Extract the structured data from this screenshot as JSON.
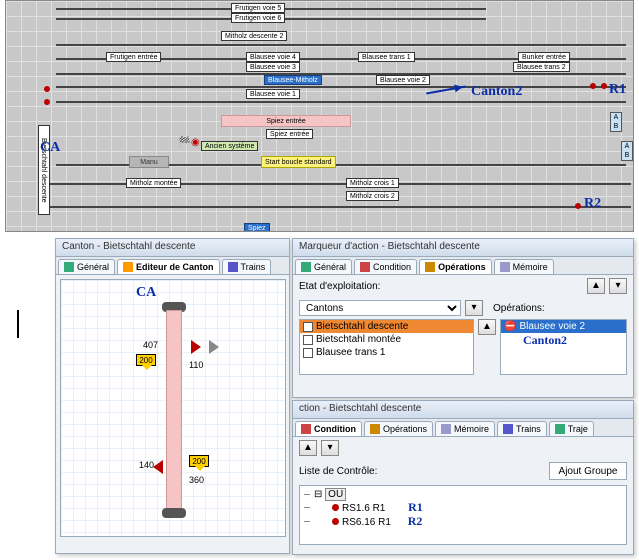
{
  "track": {
    "labels": {
      "top1": "Frutigen voie 5",
      "top2": "Frutigen voie 6",
      "frutigen_entree": "Frutigen entrée",
      "mitholz_desc2": "Mitholz descente 2",
      "blausee_v4": "Blausee voie 4",
      "blausee_v3": "Blausee voie 3",
      "blausee_mitholz": "Blausee-Mitholz",
      "blausee_v1": "Blausee voie 1",
      "blausee_trans1": "Blausee trans 1",
      "blausee_v2": "Blausee voie 2",
      "bunker_entree": "Bunker entrée",
      "blausee_trans2": "Blausee trans 2",
      "spiez_entree": "Spiez entrée",
      "spiez_entree2": "Spiez entrée",
      "ancien": "Ancien système",
      "manu": "Manu",
      "start_boucle": "Start boucle standard",
      "mitholz_montee": "Mitholz montée",
      "mitholz_crois1": "Mitholz crois 1",
      "mitholz_crois2": "Mitholz crois 2",
      "spiez_bottom": "Spiez",
      "side_vertical": "Bietschtahl descente",
      "ab_a": "A",
      "ab_b": "B"
    }
  },
  "annotations": {
    "ca": "CA",
    "canton2": "Canton2",
    "r1": "R1",
    "r2": "R2"
  },
  "canton_panel": {
    "title": "Canton - Bietschtahl descente",
    "tabs": {
      "general": "Général",
      "editor": "Editeur de Canton",
      "trains": "Trains"
    },
    "ca_label": "CA",
    "values": {
      "v407": "407",
      "v200a": "200",
      "v110": "110",
      "v140": "140",
      "v200b": "200",
      "v360": "360"
    }
  },
  "marker_panel": {
    "title": "Marqueur d'action - Bietschtahl descente",
    "tabs": {
      "general": "Général",
      "condition": "Condition",
      "operations": "Opérations",
      "memoire": "Mémoire"
    },
    "etat_label": "Etat d'exploitation:",
    "cantons_label": "Cantons",
    "operations_label": "Opérations:",
    "canton_list": {
      "i1": "Bietschtahl descente",
      "i2": "Bietschtahl montée",
      "i3": "Blausee trans 1"
    },
    "op_item": "Blausee voie 2"
  },
  "action_panel": {
    "title_suffix": "ction - Bietschtahl descente",
    "tabs": {
      "condition": "Condition",
      "operations": "Opérations",
      "memoire": "Mémoire",
      "trains": "Trains",
      "traje": "Traje"
    },
    "liste_label": "Liste de Contrôle:",
    "ajout_btn": "Ajout Groupe",
    "tree": {
      "root": "OU",
      "n1": "RS1.6 R1",
      "n2": "RS6.16 R1"
    }
  }
}
